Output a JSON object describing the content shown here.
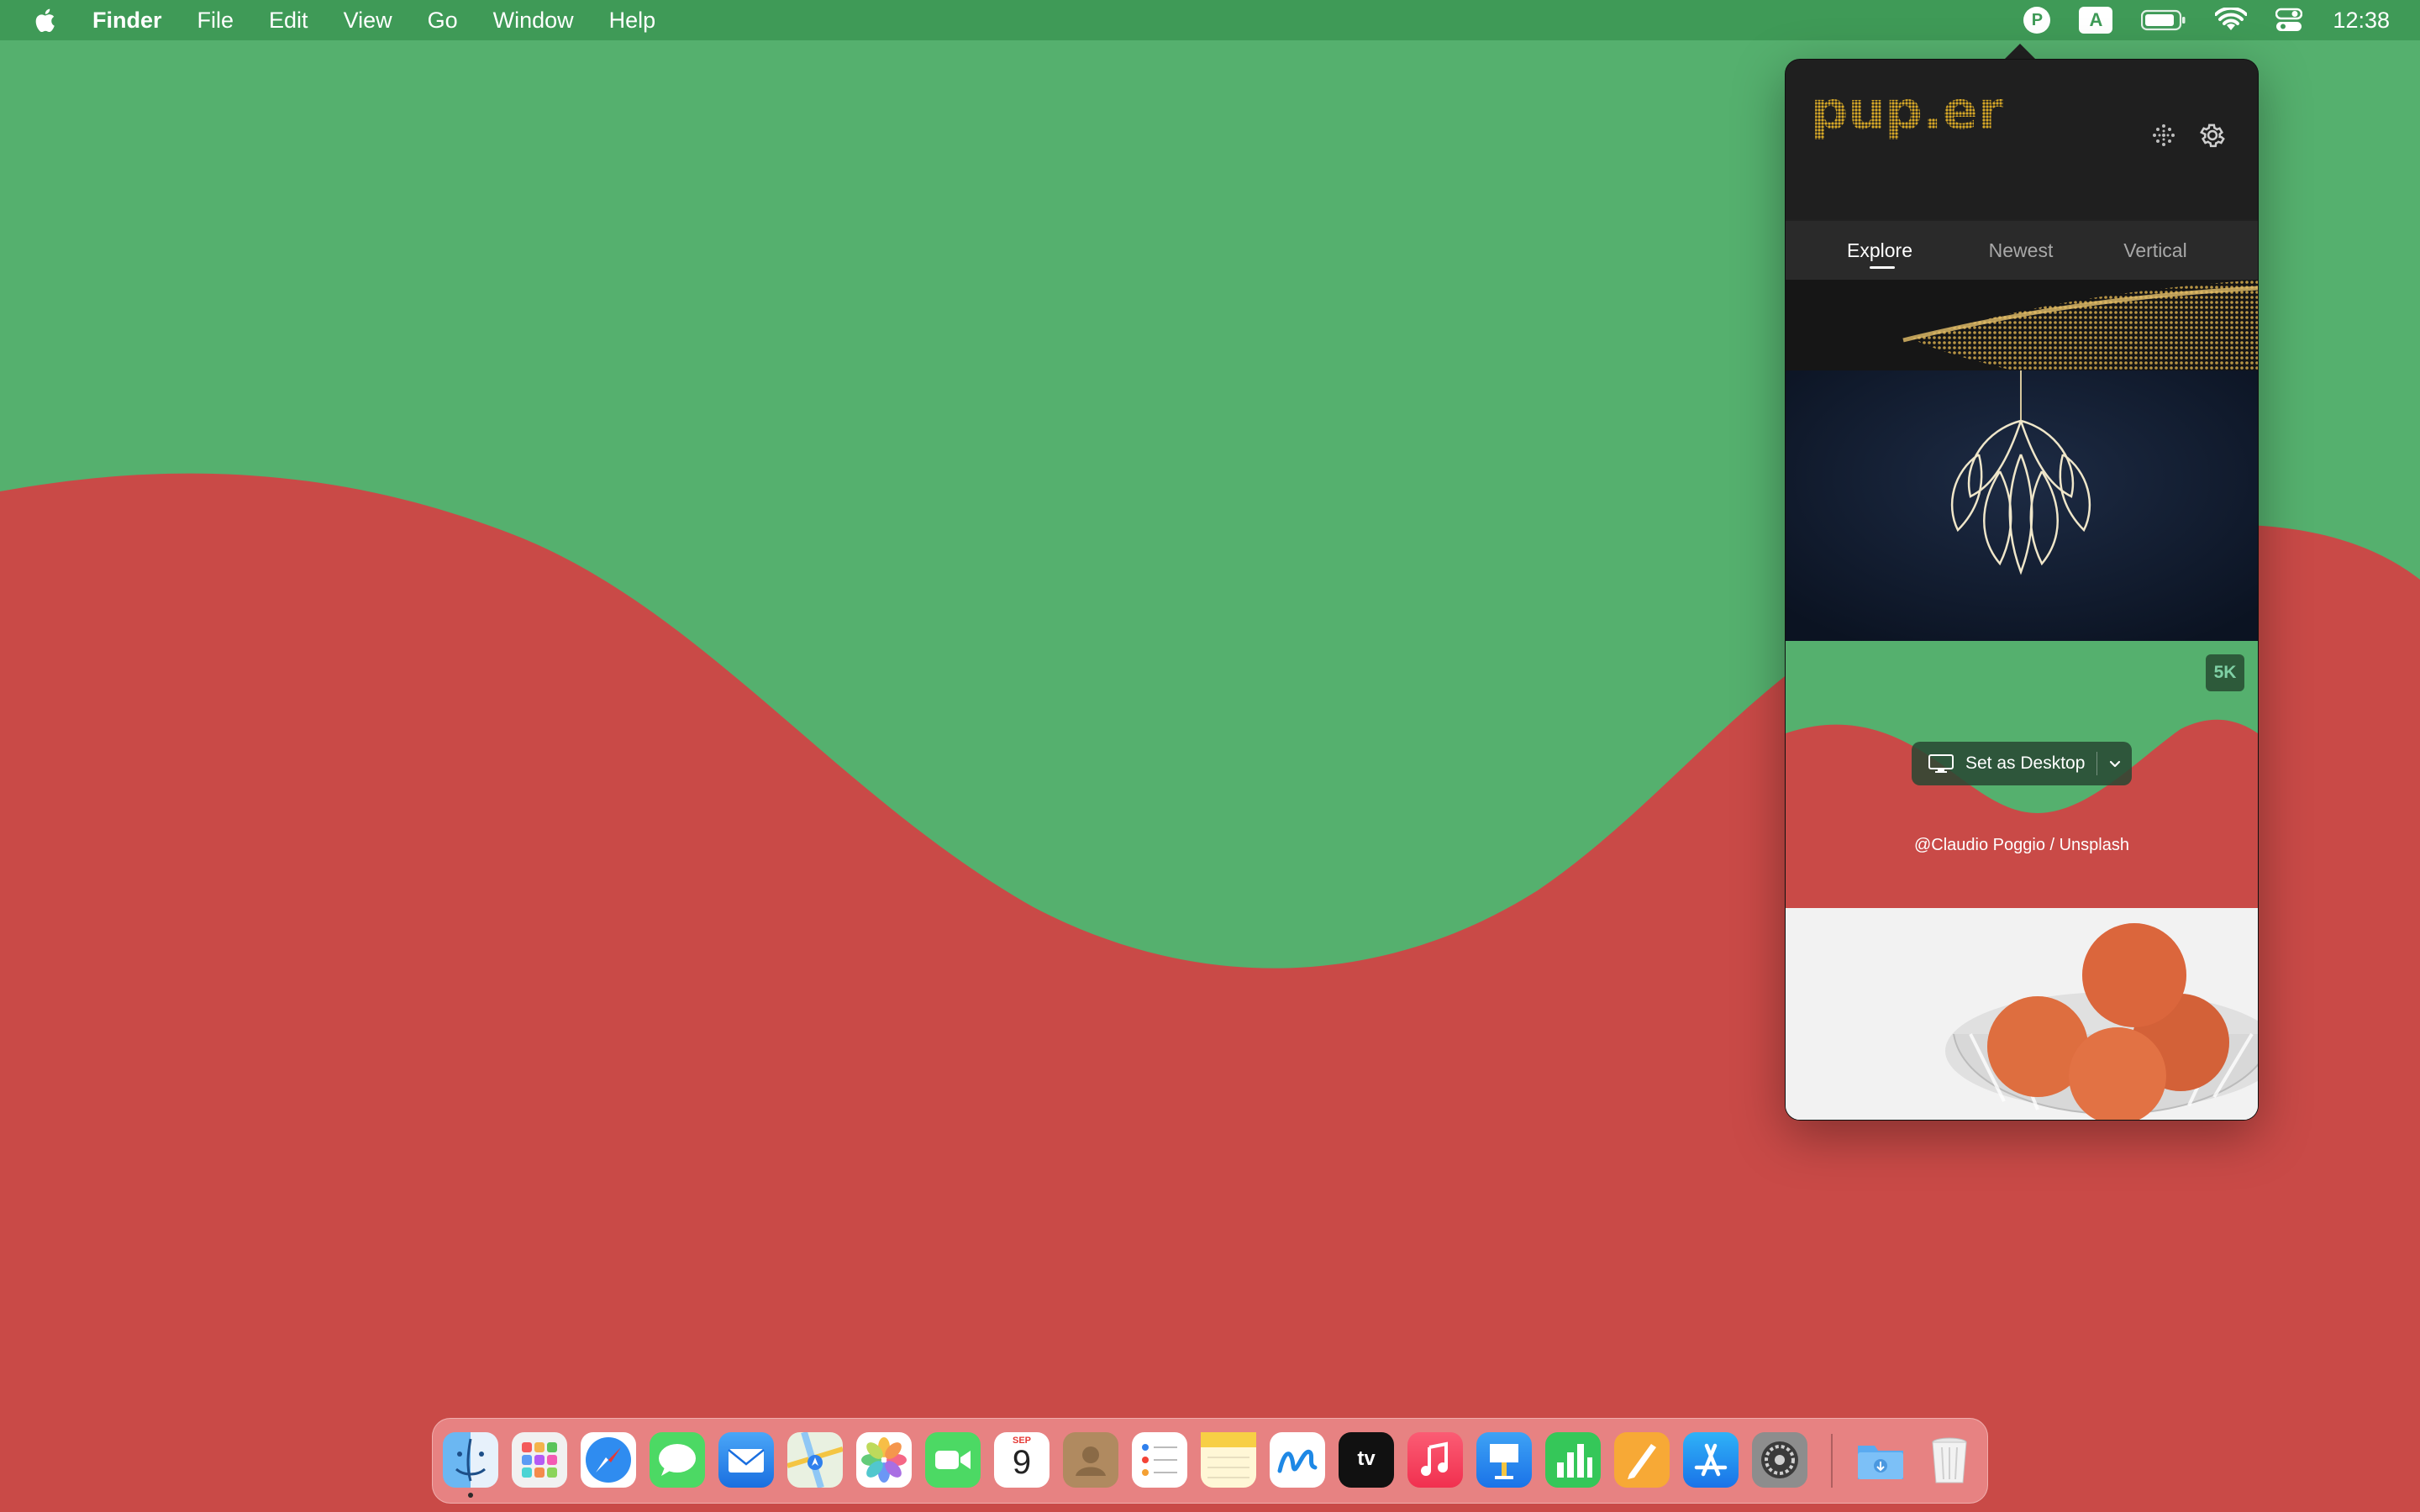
{
  "menubar": {
    "app_name": "Finder",
    "menus": [
      "File",
      "Edit",
      "View",
      "Go",
      "Window",
      "Help"
    ],
    "status_items": {
      "pupper_icon_label": "P",
      "input_source_label": "A",
      "clock": "12:38"
    }
  },
  "popover": {
    "logo_text": "pup.er",
    "tabs": [
      {
        "label": "Explore",
        "active": true
      },
      {
        "label": "Newest",
        "active": false
      },
      {
        "label": "Vertical",
        "active": false
      }
    ],
    "selected_card": {
      "resolution_badge": "5K",
      "set_desktop_label": "Set as Desktop",
      "credit": "@Claudio Poggio / Unsplash"
    }
  },
  "dock": {
    "apps": [
      "finder-icon",
      "launchpad-icon",
      "safari-icon",
      "messages-icon",
      "mail-icon",
      "maps-icon",
      "photos-icon",
      "facetime-icon",
      "calendar-icon",
      "contacts-icon",
      "reminders-icon",
      "notes-icon",
      "freeform-icon",
      "appletv-icon",
      "music-icon",
      "keynote-icon",
      "numbers-icon",
      "pages-icon",
      "appstore-icon",
      "system-settings-icon",
      "downloads-folder-icon",
      "trash-icon"
    ],
    "calendar": {
      "month": "SEP",
      "day": "9"
    },
    "appletv_label": "tv"
  },
  "colors": {
    "wallpaper_green": "#55b06e",
    "wallpaper_red": "#c94a47",
    "menubar": "#3f9a57",
    "popover_bg": "#212121"
  }
}
